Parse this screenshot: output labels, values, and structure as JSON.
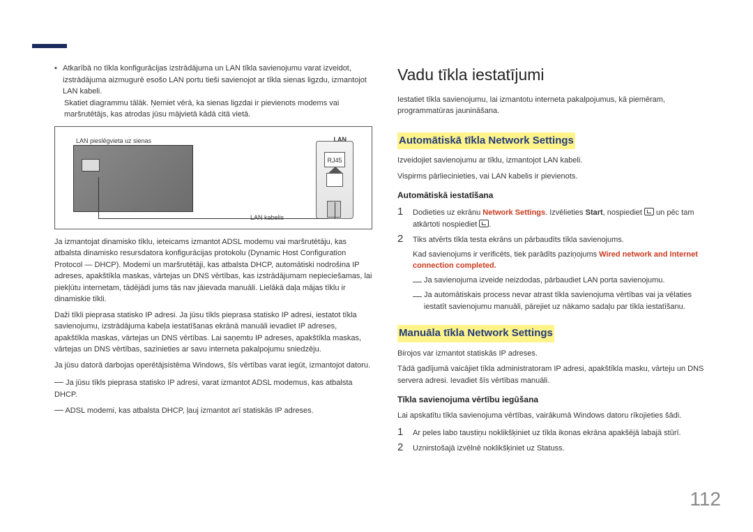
{
  "left": {
    "bullet1": "Atkarībā no tīkla konfigurācijas izstrādājuma un LAN tīkla savienojumu varat izveidot, izstrādājuma aizmugurē esošo LAN portu tieši savienojot ar tīkla sienas ligzdu, izmantojot LAN kabeli.",
    "bullet1b": "Skatiet diagrammu tālāk. Ņemiet vērā, ka sienas ligzdai ir pievienots modems vai maršrutētājs, kas atrodas jūsu mājvietā kādā citā vietā.",
    "dia_wall": "LAN pieslēgvieta uz sienas",
    "dia_lan": "LAN",
    "dia_rj45": "RJ45",
    "dia_cable": "LAN kabelis",
    "p1": "Ja izmantojat dinamisko tīklu, ieteicams izmantot ADSL modemu vai maršrutētāju, kas atbalsta dinamisko resursdatora konfigurācijas protokolu (Dynamic Host Configuration Protocol — DHCP). Modemi un maršrutētāji, kas atbalsta DHCP, automātiski nodrošina IP adreses, apakštīkla maskas, vārtejas un DNS vērtības, kas izstrādājumam nepieciešamas, lai piekļūtu internetam, tādējādi jums tās nav jāievada manuāli. Lielākā daļa mājas tīklu ir dinamiskie tīkli.",
    "p2": "Daži tīkli pieprasa statisko IP adresi. Ja jūsu tīkls pieprasa statisko IP adresi, iestatot tīkla savienojumu, izstrādājuma kabeļa iestatīšanas ekrānā manuāli ievadiet IP adreses, apakštīkla maskas, vārtejas un DNS vērtības. Lai saņemtu IP adreses, apakštīkla maskas, vārtejas un DNS vērtības, sazinieties ar savu interneta pakalpojumu sniedzēju.",
    "p3": "Ja jūsu datorā darbojas operētājsistēma Windows, šīs vērtības varat iegūt, izmantojot datoru.",
    "d1": "Ja jūsu tīkls pieprasa statisko IP adresi, varat izmantot ADSL modemus, kas atbalsta DHCP.",
    "d2": "ADSL modemi, kas atbalsta DHCP, ļauj izmantot arī statiskās IP adreses."
  },
  "right": {
    "h1": "Vadu tīkla iestatījumi",
    "intro": "Iestatiet tīkla savienojumu, lai izmantotu interneta pakalpojumus, kā piemēram, programmatūras jaunināšana.",
    "h2a": "Automātiskā tīkla Network Settings",
    "a_p1": "Izveidojiet savienojumu ar tīklu, izmantojot LAN kabeli.",
    "a_p2": "Vispirms pārliecinieties, vai LAN kabelis ir pievienots.",
    "h3a": "Automātiskā iestatīšana",
    "s1a": "Dodieties uz ekrānu ",
    "s1ns": "Network Settings",
    "s1b": ". Izvēlieties ",
    "s1start": "Start",
    "s1c": ", nospiediet ",
    "s1d": " un pēc tam atkārtoti nospiediet ",
    "s1e": ".",
    "s2": "Tiks atvērts tīkla testa ekrāns un pārbaudīts tīkla savienojums.",
    "s2sub": "Kad savienojums ir verificēts, tiek parādīts paziņojums ",
    "s2bold": "Wired network and Internet connection completed.",
    "d1": "Ja savienojuma izveide neizdodas, pārbaudiet LAN porta savienojumu.",
    "d2": "Ja automātiskais process nevar atrast tīkla savienojuma vērtības vai ja vēlaties iestatīt savienojumu manuāli, pārejiet uz nākamo sadaļu par tīkla iestatīšanu.",
    "h2b": "Manuāla tīkla Network Settings",
    "b_p1": "Birojos var izmantot statiskās IP adreses.",
    "b_p2": "Tādā gadījumā vaicājiet tīkla administratoram IP adresi, apakštīkla masku, vārteju un DNS servera adresi. Ievadiet šīs vērtības manuāli.",
    "h3b": "Tīkla savienojuma vērtību iegūšana",
    "b_pre": "Lai apskatītu tīkla savienojuma vērtības, vairākumā Windows datoru rīkojieties šādi.",
    "bs1": "Ar peles labo taustiņu noklikšķiniet uz tīkla ikonas ekrāna apakšējā labajā stūrī.",
    "bs2": "Uznirstošajā izvēlnē noklikšķiniet uz Statuss."
  },
  "pagenum": "112"
}
